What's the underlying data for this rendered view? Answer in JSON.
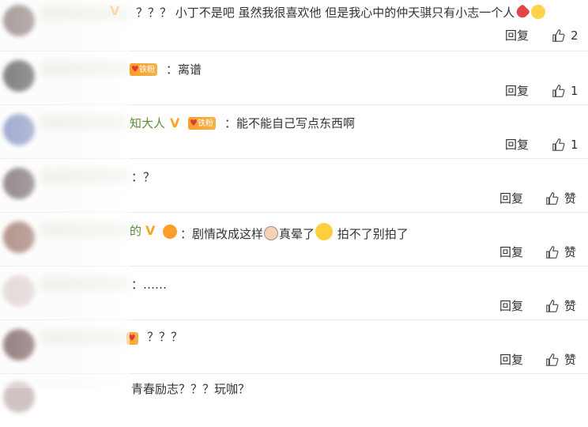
{
  "comments": [
    {
      "name_tail": "",
      "has_v": true,
      "fan_badge": "",
      "text": "？？？ 小丁不是吧 虽然我很喜欢他 但是我心中的仲天骐只有小志一个人",
      "emoji_after": [
        "broken-heart-emoji",
        "crying-emoji"
      ],
      "reply": "回复",
      "likes": "2"
    },
    {
      "name_tail": "",
      "has_v": false,
      "fan_badge": "铁粉",
      "text": "：离谱",
      "reply": "回复",
      "likes": "1"
    },
    {
      "name_tail": "知大人",
      "has_v": true,
      "fan_badge": "铁粉",
      "text": "：能不能自己写点东西啊",
      "reply": "回复",
      "likes": "1"
    },
    {
      "name_tail": "",
      "has_v": false,
      "fan_badge": "",
      "text": "：？",
      "reply": "回复",
      "likes": "赞"
    },
    {
      "name_tail": "的",
      "has_v": true,
      "fan_badge": "",
      "text_part1": "：剧情改成这样",
      "text_part2": "真晕了",
      "text_part3": " 拍不了别拍了",
      "reply": "回复",
      "likes": "赞"
    },
    {
      "name_tail": "",
      "has_v": false,
      "fan_badge": "",
      "text": "：……",
      "reply": "回复",
      "likes": "赞"
    },
    {
      "name_tail": "",
      "has_v": false,
      "fan_badge": "",
      "text": "？？？",
      "reply": "回复",
      "likes": "赞"
    },
    {
      "name_tail": "",
      "has_v": false,
      "fan_badge": "",
      "text": "青春励志？？？玩咖？",
      "reply": "",
      "likes": ""
    }
  ],
  "colors": {
    "name_green": "#5b8c3a",
    "v_gold": "#f5a623",
    "badge_orange": "#ff9d2a",
    "divider": "#ececec"
  }
}
